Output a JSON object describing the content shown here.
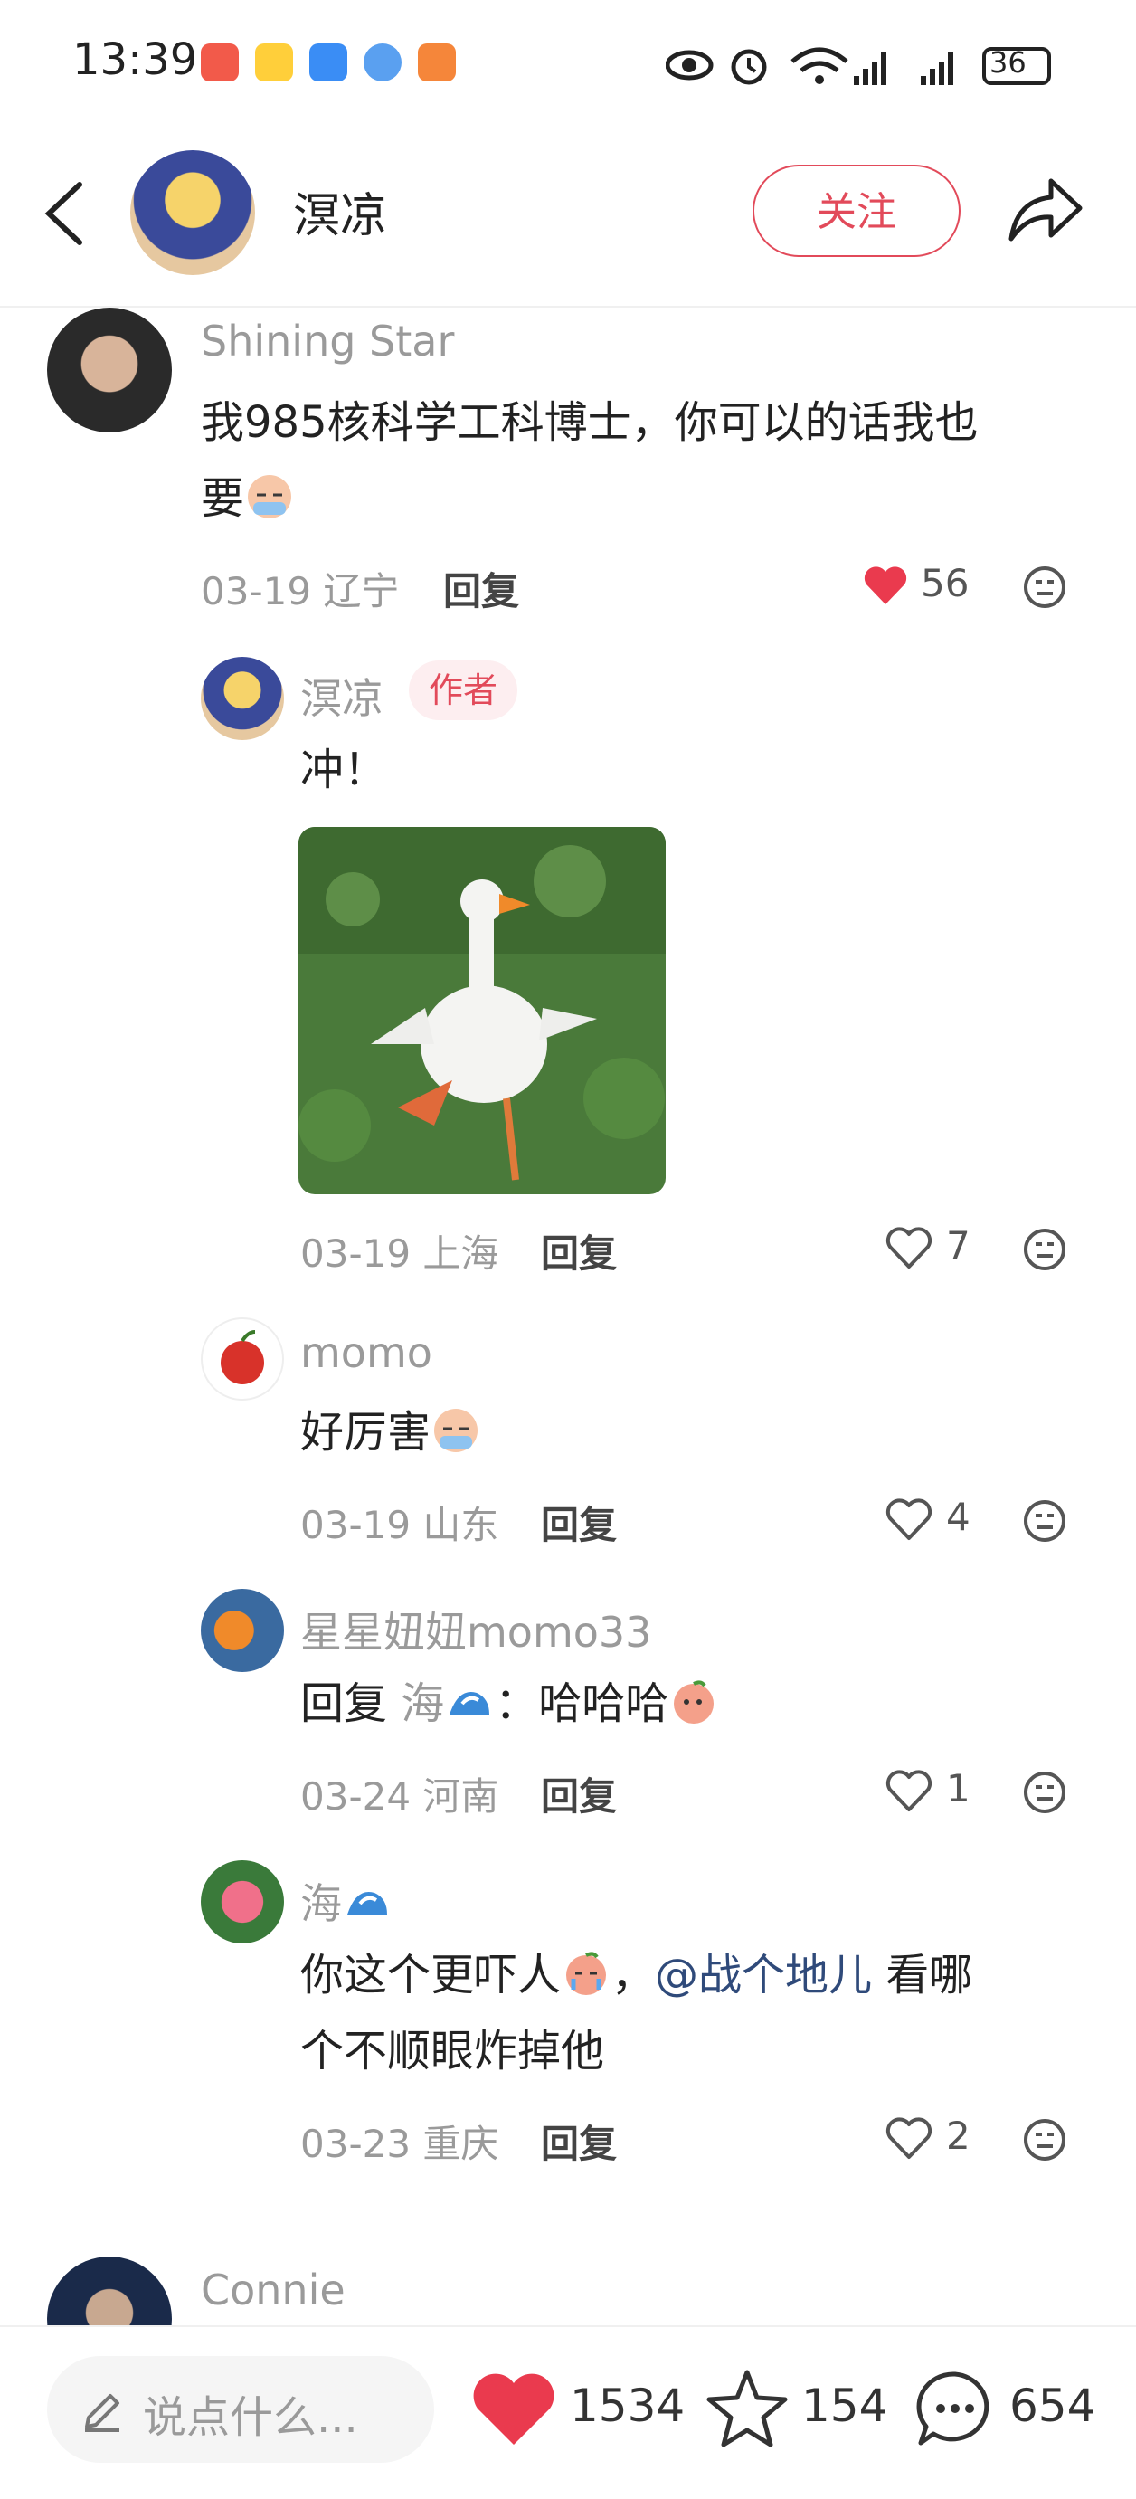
{
  "status_bar": {
    "time": "13:39",
    "battery": "36"
  },
  "header": {
    "author_name": "溟凉",
    "follow_label": "关注"
  },
  "comments": [
    {
      "user": "Shining Star",
      "text_line1": "我985核科学工科博士，你可以的话我也",
      "text_line2": "要",
      "date": "03-19 辽宁",
      "reply_label": "回复",
      "likes": "56",
      "liked": true
    },
    {
      "user": "溟凉",
      "badge": "作者",
      "text": "冲！",
      "date": "03-19 上海",
      "reply_label": "回复",
      "likes": "7"
    },
    {
      "user": "momo",
      "text": "好厉害",
      "date": "03-19 山东",
      "reply_label": "回复",
      "likes": "4"
    },
    {
      "user": "星星妞妞momo33",
      "text_prefix": "回复",
      "reply_to": "海",
      "text_suffix": "：哈哈哈",
      "date": "03-24 河南",
      "reply_label": "回复",
      "likes": "1"
    },
    {
      "user": "海",
      "text_a": "你这个更吓人",
      "text_b": "，",
      "mention": "@战个地儿",
      "text_c": " 看哪",
      "text_line2": "个不顺眼炸掉他",
      "date": "03-23 重庆",
      "reply_label": "回复",
      "likes": "2"
    },
    {
      "user": "Connie"
    }
  ],
  "bottom_bar": {
    "input_placeholder": "说点什么...",
    "likes": "1534",
    "stars": "154",
    "comments": "654"
  },
  "colors": {
    "accent": "#e24a5a",
    "mention": "#2f4a7a"
  }
}
